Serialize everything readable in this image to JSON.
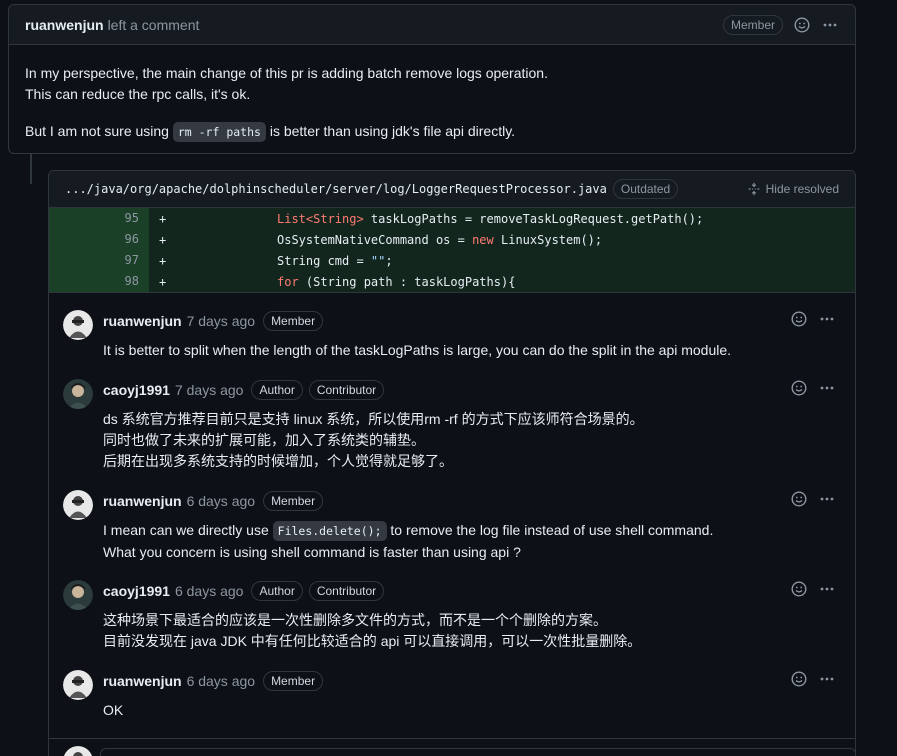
{
  "top_comment": {
    "author": "ruanwenjun",
    "action": "left a comment",
    "badge": "Member",
    "lines": [
      "In my perspective, the main change of this pr is adding batch remove logs operation.",
      "This can reduce the rpc calls, it's ok."
    ],
    "line3_before": "But I am not sure using ",
    "line3_code": "rm -rf paths",
    "line3_after": " is better than using jdk's file api directly."
  },
  "review": {
    "file_path": ".../java/org/apache/dolphinscheduler/server/log/LoggerRequestProcessor.java",
    "outdated_label": "Outdated",
    "hide_resolved_label": "Hide resolved",
    "diff_lines": [
      {
        "num": "95",
        "sign": "+"
      },
      {
        "num": "96",
        "sign": "+"
      },
      {
        "num": "97",
        "sign": "+"
      },
      {
        "num": "98",
        "sign": "+"
      }
    ],
    "code": {
      "l95_a": "List<String>",
      "l95_b": " taskLogPaths = removeTaskLogRequest.getPath();",
      "l96_a": "OsSystemNativeCommand os = ",
      "l96_kw": "new",
      "l96_b": " LinuxSystem();",
      "l97_a": "String cmd = ",
      "l97_str": "\"\"",
      "l97_b": ";",
      "l98_kw": "for",
      "l98_b": " (String path : taskLogPaths){"
    }
  },
  "comments": [
    {
      "author": "ruanwenjun",
      "time": "7 days ago",
      "badges": [
        "Member"
      ],
      "lines": [
        "It is better to split when the length of the taskLogPaths is large, you can do the split in the api module."
      ]
    },
    {
      "author": "caoyj1991",
      "time": "7 days ago",
      "badges": [
        "Author",
        "Contributor"
      ],
      "lines": [
        "ds 系统官方推荐目前只是支持 linux 系统，所以使用rm -rf 的方式下应该师符合场景的。",
        "同时也做了未来的扩展可能，加入了系统类的辅垫。",
        "后期在出现多系统支持的时候增加，个人觉得就足够了。"
      ]
    },
    {
      "author": "ruanwenjun",
      "time": "6 days ago",
      "badges": [
        "Member"
      ],
      "line1_before": "I mean can we directly use ",
      "line1_code": "Files.delete();",
      "line1_after": " to remove the log file instead of use shell command.",
      "lines": [
        "What you concern is using shell command is faster than using api ?"
      ]
    },
    {
      "author": "caoyj1991",
      "time": "6 days ago",
      "badges": [
        "Author",
        "Contributor"
      ],
      "lines": [
        "这种场景下最适合的应该是一次性删除多文件的方式，而不是一个个删除的方案。",
        "目前没发现在 java JDK 中有任何比较适合的 api 可以直接调用，可以一次性批量删除。"
      ]
    },
    {
      "author": "ruanwenjun",
      "time": "6 days ago",
      "badges": [
        "Member"
      ],
      "lines": [
        "OK"
      ]
    }
  ]
}
